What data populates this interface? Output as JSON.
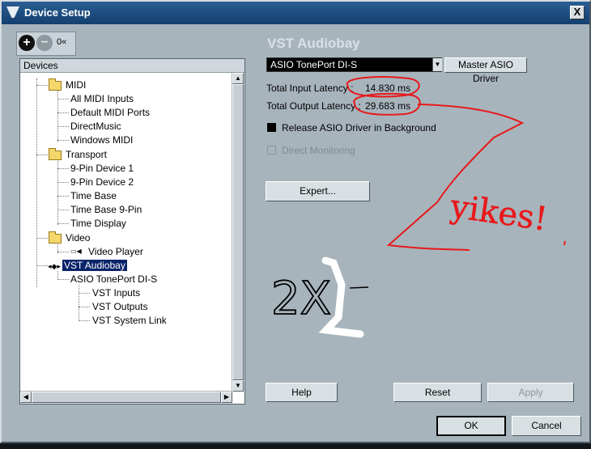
{
  "window": {
    "title": "Device Setup",
    "close_symbol": "X"
  },
  "toolbar": {
    "add": "+",
    "remove": "−",
    "collapse": "0«"
  },
  "tree": {
    "header": "Devices",
    "items": [
      {
        "label": "MIDI"
      },
      {
        "label": "All MIDI Inputs"
      },
      {
        "label": "Default MIDI Ports"
      },
      {
        "label": "DirectMusic"
      },
      {
        "label": "Windows MIDI"
      },
      {
        "label": "Transport"
      },
      {
        "label": "9-Pin Device 1"
      },
      {
        "label": "9-Pin Device 2"
      },
      {
        "label": "Time Base"
      },
      {
        "label": "Time Base 9-Pin"
      },
      {
        "label": "Time Display"
      },
      {
        "label": "Video"
      },
      {
        "label": "Video Player"
      },
      {
        "label": "VST Audiobay"
      },
      {
        "label": "ASIO TonePort DI-S"
      },
      {
        "label": "VST Inputs"
      },
      {
        "label": "VST Outputs"
      },
      {
        "label": "VST System Link"
      }
    ]
  },
  "panel": {
    "title": "VST Audiobay",
    "driver": "ASIO TonePort DI-S",
    "master_button": "Master ASIO Driver",
    "input_latency_label": "Total Input Latency :",
    "input_latency_value": "14.830 ms",
    "output_latency_label": "Total Output Latency :",
    "output_latency_value": "29.683 ms",
    "release_label": "Release ASIO Driver in Background",
    "monitoring_label": "Direct Monitoring",
    "expert_button": "Expert...",
    "help_button": "Help",
    "reset_button": "Reset",
    "apply_button": "Apply"
  },
  "footer": {
    "ok_button": "OK",
    "cancel_button": "Cancel"
  },
  "annotation": {
    "text": "yikes!",
    "math": "2X"
  },
  "colors": {
    "annotation_red": "#e8191b",
    "selection": "#0a246a",
    "background": "#a7b4bc"
  }
}
